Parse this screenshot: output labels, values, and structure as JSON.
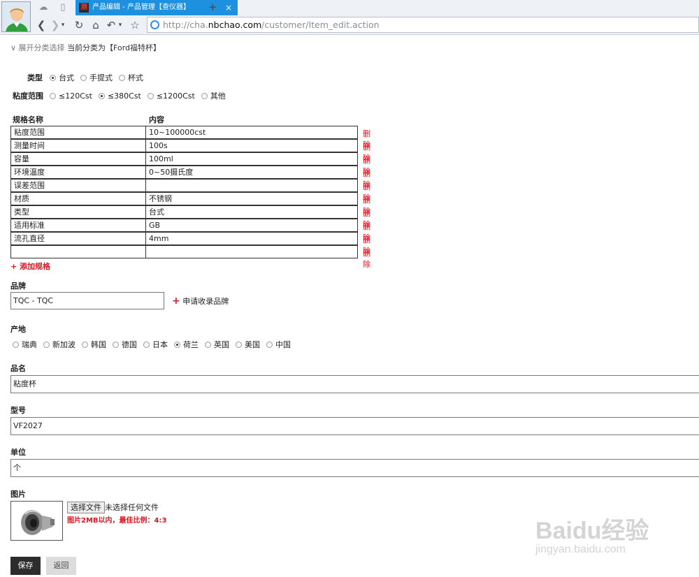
{
  "browser": {
    "tab_title": "产品编辑 - 产品管理【查仪器】",
    "tab_favicon_char": "测",
    "tab_close": "×",
    "new_tab": "+",
    "url_prefix": "http://cha.",
    "url_host": "nbchao.com",
    "url_path": "/customer/Item_edit.action"
  },
  "breadcrumb": {
    "expand_label": "∨ 展开分类选择",
    "current_prefix": "当前分类为",
    "current_value": "【Ford福特杯】"
  },
  "type_group": {
    "label": "类型",
    "options": [
      {
        "label": "台式",
        "checked": true
      },
      {
        "label": "手提式",
        "checked": false
      },
      {
        "label": "杯式",
        "checked": false
      }
    ]
  },
  "viscosity_group": {
    "label": "粘度范围",
    "options": [
      {
        "label": "≤120Cst",
        "checked": false
      },
      {
        "label": "≤380Cst",
        "checked": true
      },
      {
        "label": "≤1200Cst",
        "checked": false
      },
      {
        "label": "其他",
        "checked": false
      }
    ]
  },
  "spec_table": {
    "header_name": "规格名称",
    "header_content": "内容",
    "delete_label": "删除",
    "rows": [
      {
        "name": "粘度范围",
        "content": "10~100000cst"
      },
      {
        "name": "测量时间",
        "content": "100s"
      },
      {
        "name": "容量",
        "content": "100ml"
      },
      {
        "name": "环境温度",
        "content": "0~50摄氏度"
      },
      {
        "name": "误差范围",
        "content": ""
      },
      {
        "name": "材质",
        "content": "不锈钢"
      },
      {
        "name": "类型",
        "content": "台式"
      },
      {
        "name": "适用标准",
        "content": "GB"
      },
      {
        "name": "流孔直径",
        "content": "4mm"
      },
      {
        "name": "",
        "content": ""
      }
    ],
    "add_label": "+ 添加规格"
  },
  "brand": {
    "label": "品牌",
    "value": "TQC - TQC",
    "request_plus": "+",
    "request_label": "申请收录品牌"
  },
  "origin": {
    "label": "产地",
    "options": [
      {
        "label": "瑞典",
        "checked": false
      },
      {
        "label": "新加波",
        "checked": false
      },
      {
        "label": "韩国",
        "checked": false
      },
      {
        "label": "德国",
        "checked": false
      },
      {
        "label": "日本",
        "checked": false
      },
      {
        "label": "荷兰",
        "checked": true
      },
      {
        "label": "英国",
        "checked": false
      },
      {
        "label": "美国",
        "checked": false
      },
      {
        "label": "中国",
        "checked": false
      }
    ]
  },
  "product_name": {
    "label": "品名",
    "value": "粘度杯"
  },
  "model": {
    "label": "型号",
    "value": "VF2027"
  },
  "unit": {
    "label": "单位",
    "value": "个"
  },
  "image": {
    "label": "图片",
    "choose_file_label": "选择文件",
    "file_status": "未选择任何文件",
    "hint": "图片2MB以内，最佳比例：4:3"
  },
  "actions": {
    "save_label": "保存",
    "back_label": "返回"
  },
  "watermark": {
    "main": "Baidu经验",
    "sub": "jingyan.baidu.com"
  },
  "colors": {
    "accent_red": "#e0141e",
    "tab_blue": "#1e90e0",
    "save_dark": "#2c2c2c"
  }
}
